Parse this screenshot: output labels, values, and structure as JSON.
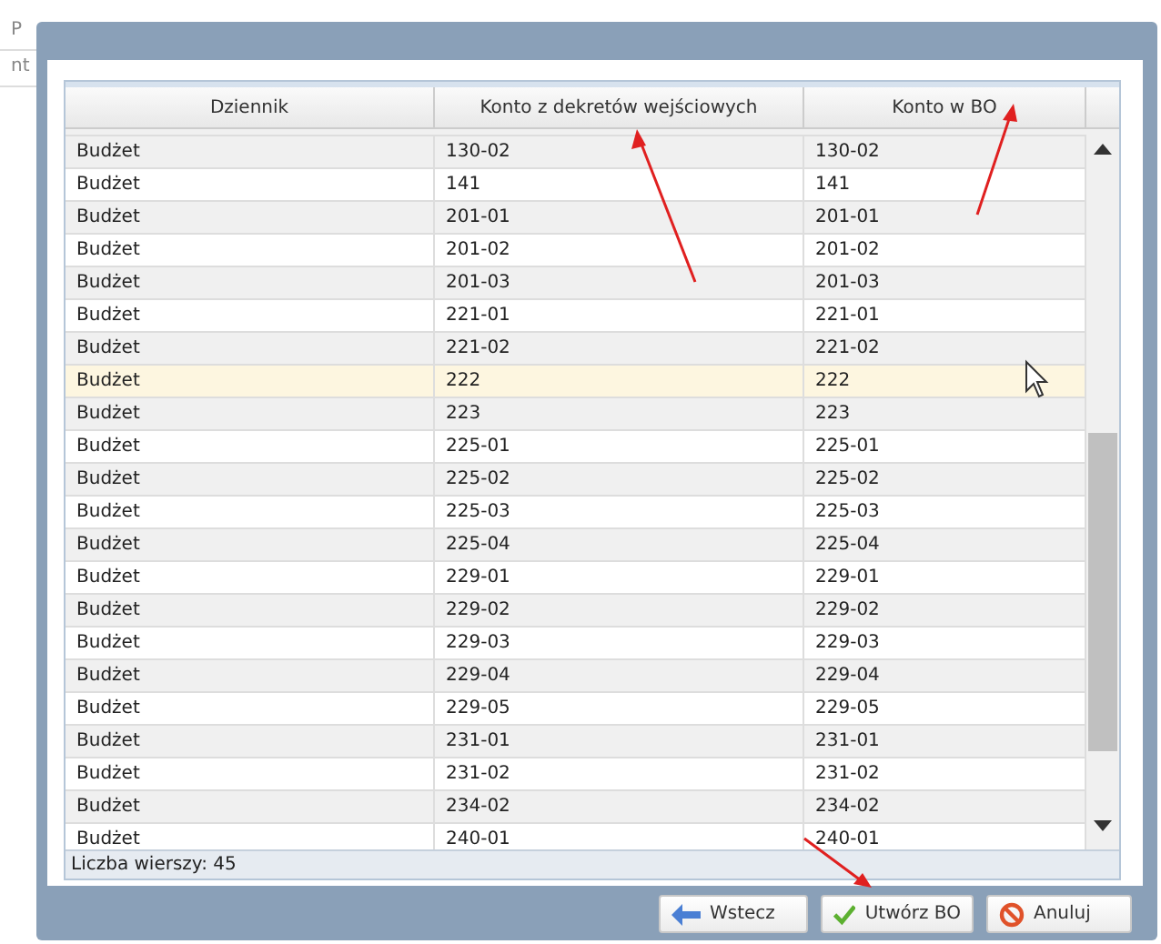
{
  "background_app": {
    "texts": [
      "P",
      "nt"
    ]
  },
  "grid": {
    "columns": [
      "Dziennik",
      "Konto z dekretów wejściowych",
      "Konto w BO"
    ],
    "rows": [
      {
        "cells": [
          "Budżet",
          "130-02",
          "130-02"
        ],
        "hovered": false
      },
      {
        "cells": [
          "Budżet",
          "141",
          "141"
        ],
        "hovered": false
      },
      {
        "cells": [
          "Budżet",
          "201-01",
          "201-01"
        ],
        "hovered": false
      },
      {
        "cells": [
          "Budżet",
          "201-02",
          "201-02"
        ],
        "hovered": false
      },
      {
        "cells": [
          "Budżet",
          "201-03",
          "201-03"
        ],
        "hovered": false
      },
      {
        "cells": [
          "Budżet",
          "221-01",
          "221-01"
        ],
        "hovered": false
      },
      {
        "cells": [
          "Budżet",
          "221-02",
          "221-02"
        ],
        "hovered": false
      },
      {
        "cells": [
          "Budżet",
          "222",
          "222"
        ],
        "hovered": true
      },
      {
        "cells": [
          "Budżet",
          "223",
          "223"
        ],
        "hovered": false
      },
      {
        "cells": [
          "Budżet",
          "225-01",
          "225-01"
        ],
        "hovered": false
      },
      {
        "cells": [
          "Budżet",
          "225-02",
          "225-02"
        ],
        "hovered": false
      },
      {
        "cells": [
          "Budżet",
          "225-03",
          "225-03"
        ],
        "hovered": false
      },
      {
        "cells": [
          "Budżet",
          "225-04",
          "225-04"
        ],
        "hovered": false
      },
      {
        "cells": [
          "Budżet",
          "229-01",
          "229-01"
        ],
        "hovered": false
      },
      {
        "cells": [
          "Budżet",
          "229-02",
          "229-02"
        ],
        "hovered": false
      },
      {
        "cells": [
          "Budżet",
          "229-03",
          "229-03"
        ],
        "hovered": false
      },
      {
        "cells": [
          "Budżet",
          "229-04",
          "229-04"
        ],
        "hovered": false
      },
      {
        "cells": [
          "Budżet",
          "229-05",
          "229-05"
        ],
        "hovered": false
      },
      {
        "cells": [
          "Budżet",
          "231-01",
          "231-01"
        ],
        "hovered": false
      },
      {
        "cells": [
          "Budżet",
          "231-02",
          "231-02"
        ],
        "hovered": false
      },
      {
        "cells": [
          "Budżet",
          "234-02",
          "234-02"
        ],
        "hovered": false
      },
      {
        "cells": [
          "Budżet",
          "240-01",
          "240-01"
        ],
        "hovered": false
      }
    ],
    "footer": "Liczba wierszy: 45"
  },
  "buttons": [
    {
      "label": "Wstecz",
      "kind": "back"
    },
    {
      "label": "Utwórz BO",
      "kind": "confirm"
    },
    {
      "label": "Anuluj",
      "kind": "cancel"
    }
  ]
}
